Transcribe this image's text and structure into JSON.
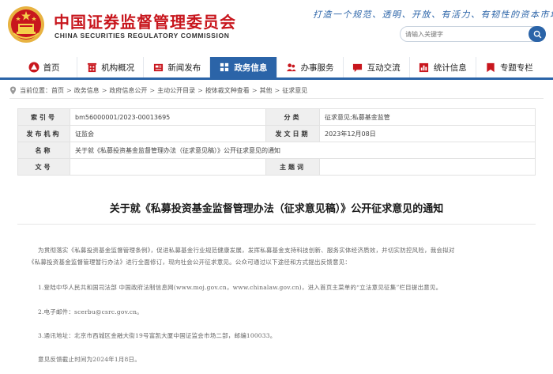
{
  "header": {
    "org_name_cn": "中国证券监督管理委员会",
    "org_name_en": "CHINA SECURITIES REGULATORY COMMISSION",
    "slogan": "打造一个规范、透明、开放、有活力、有韧性的资本市场",
    "search_placeholder": "请输入关键字",
    "emblem_icon": "national-emblem-icon",
    "search_icon": "search-icon"
  },
  "nav": {
    "active_color": "#2b64a8",
    "items": [
      {
        "label": "首页",
        "icon": "logo-icon"
      },
      {
        "label": "机构概况",
        "icon": "building-icon"
      },
      {
        "label": "新闻发布",
        "icon": "newspaper-icon"
      },
      {
        "label": "政务信息",
        "icon": "grid-icon",
        "active": true
      },
      {
        "label": "办事服务",
        "icon": "people-icon"
      },
      {
        "label": "互动交流",
        "icon": "chat-icon"
      },
      {
        "label": "统计信息",
        "icon": "chart-icon"
      },
      {
        "label": "专题专栏",
        "icon": "bookmark-icon"
      }
    ]
  },
  "breadcrumb": {
    "prefix": "当前位置：",
    "items": [
      "首页",
      "政务信息",
      "政府信息公开",
      "主动公开目录",
      "按体裁文种查看",
      "其他",
      "征求意见"
    ],
    "separator": ">"
  },
  "info_table": {
    "rows": [
      {
        "k1": "索引号",
        "v1": "bm56000001/2023-00013695",
        "k2": "分类",
        "v2": "征求意见;私募基金监管"
      },
      {
        "k1": "发布机构",
        "v1": "证监会",
        "k2": "发文日期",
        "v2": "2023年12月08日"
      },
      {
        "k1": "名称",
        "v1": "关于就《私募投资基金监督管理办法（征求意见稿）》公开征求意见的通知",
        "k2": "",
        "v2": ""
      },
      {
        "k1": "文号",
        "v1": "",
        "k2": "主题词",
        "v2": ""
      }
    ]
  },
  "article": {
    "title": "关于就《私募投资基金监督管理办法（征求意见稿）》公开征求意见的通知",
    "paragraphs": [
      "为贯彻落实《私募投资基金监督管理条例》，促进私募基金行业规范健康发展，发挥私募基金支持科技创新、服务实体经济质效，并切实防控风险，我会拟对",
      "《私募投资基金监督管理暂行办法》进行全面修订，现向社会公开征求意见。公众可通过以下途径和方式提出反馈意见：",
      "1.登陆中华人民共和国司法部 中国政府法制信息网(www.moj.gov.cn，www.chinalaw.gov.cn)，进入首页主菜单的“立法意见征集”栏目提出意见。",
      "2.电子邮件：scerbu@csrc.gov.cn。",
      "3.通讯地址：北京市西城区金融大街19号富凯大厦中国证监会市场二部，邮编100033。",
      "意见反馈截止时间为2024年1月8日。"
    ]
  }
}
